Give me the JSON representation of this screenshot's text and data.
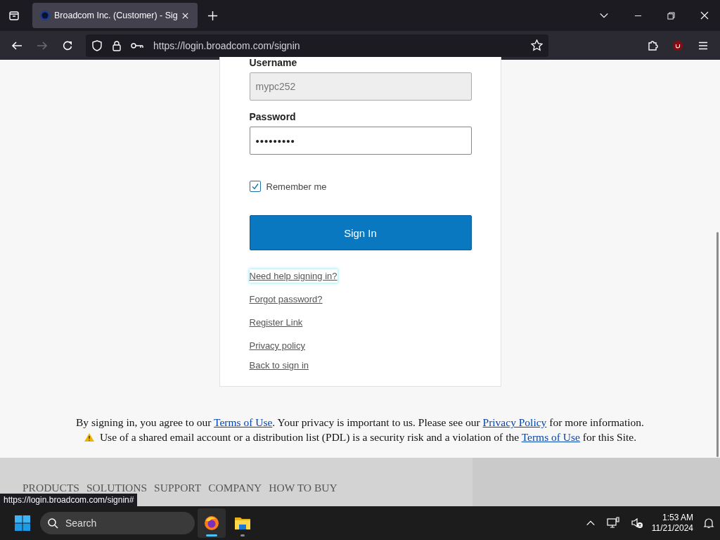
{
  "browser": {
    "tabs": [
      {
        "title": "Broadcom Inc. (Customer) - Sig",
        "selected": true
      }
    ],
    "url": "https://login.broadcom.com/signin"
  },
  "form": {
    "username": {
      "label": "Username",
      "value": "mypc252",
      "disabled": true
    },
    "password": {
      "label": "Password",
      "value": "•••••••••"
    },
    "remember": {
      "label": "Remember me",
      "checked": true
    },
    "submit": "Sign In",
    "links": [
      "Need help signing in?",
      "Forgot password?",
      "Register Link",
      "Privacy policy",
      "Back to sign in"
    ]
  },
  "terms": {
    "line1": [
      {
        "kind": "text",
        "text": "By signing in, you agree to our "
      },
      {
        "kind": "link",
        "text": "Terms of Use"
      },
      {
        "kind": "text",
        "text": ". Your privacy is important to us. Please see our "
      },
      {
        "kind": "link",
        "text": "Privacy Policy"
      },
      {
        "kind": "text",
        "text": " for more information."
      }
    ],
    "line2": [
      {
        "kind": "text",
        "text": "Use of a shared email account or a distribution list (PDL) is a security risk and a violation of the "
      },
      {
        "kind": "link",
        "text": "Terms of Use"
      },
      {
        "kind": "text",
        "text": " for this Site."
      }
    ]
  },
  "footer_nav": [
    "PRODUCTS",
    "SOLUTIONS",
    "SUPPORT",
    "COMPANY",
    "HOW TO BUY"
  ],
  "status_url": "https://login.broadcom.com/signin#",
  "taskbar": {
    "search_placeholder": "Search",
    "apps": [
      {
        "kind": "firefox",
        "selected": true
      },
      {
        "kind": "files",
        "selected": false
      }
    ],
    "time": "1:53 AM",
    "date": "11/21/2024"
  }
}
